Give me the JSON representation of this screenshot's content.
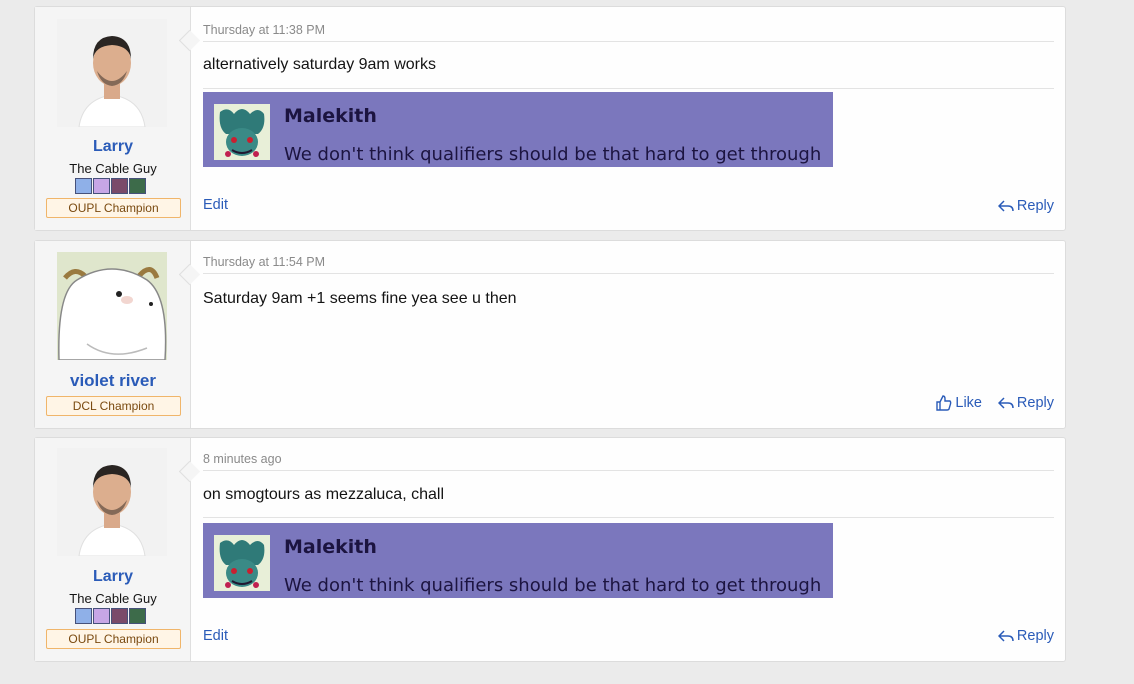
{
  "posts": [
    {
      "author": "Larry",
      "user_title": "The Cable Guy",
      "banner": "OUPL Champion",
      "date": "Thursday at 11:38 PM",
      "message": "alternatively saturday 9am works",
      "quote": {
        "name": "Malekith",
        "text": "We don't think qualifiers should be that hard to get through"
      },
      "edit_label": "Edit",
      "reply_label": "Reply"
    },
    {
      "author": "violet river",
      "banner": "DCL Champion",
      "date": "Thursday at 11:54 PM",
      "message": "Saturday 9am +1 seems fine yea see u then",
      "like_label": "Like",
      "reply_label": "Reply"
    },
    {
      "author": "Larry",
      "user_title": "The Cable Guy",
      "banner": "OUPL Champion",
      "date": "8 minutes ago",
      "message": "on smogtours as mezzaluca, chall",
      "quote": {
        "name": "Malekith",
        "text": "We don't think qualifiers should be that hard to get through"
      },
      "edit_label": "Edit",
      "reply_label": "Reply"
    }
  ],
  "icons": {
    "reply": "reply-icon",
    "like": "thumbs-up-icon"
  },
  "colors": {
    "link": "#2a5bb8",
    "quote_bg": "#7b77bd",
    "banner_border": "#f0b56a",
    "background": "#ebebeb"
  }
}
